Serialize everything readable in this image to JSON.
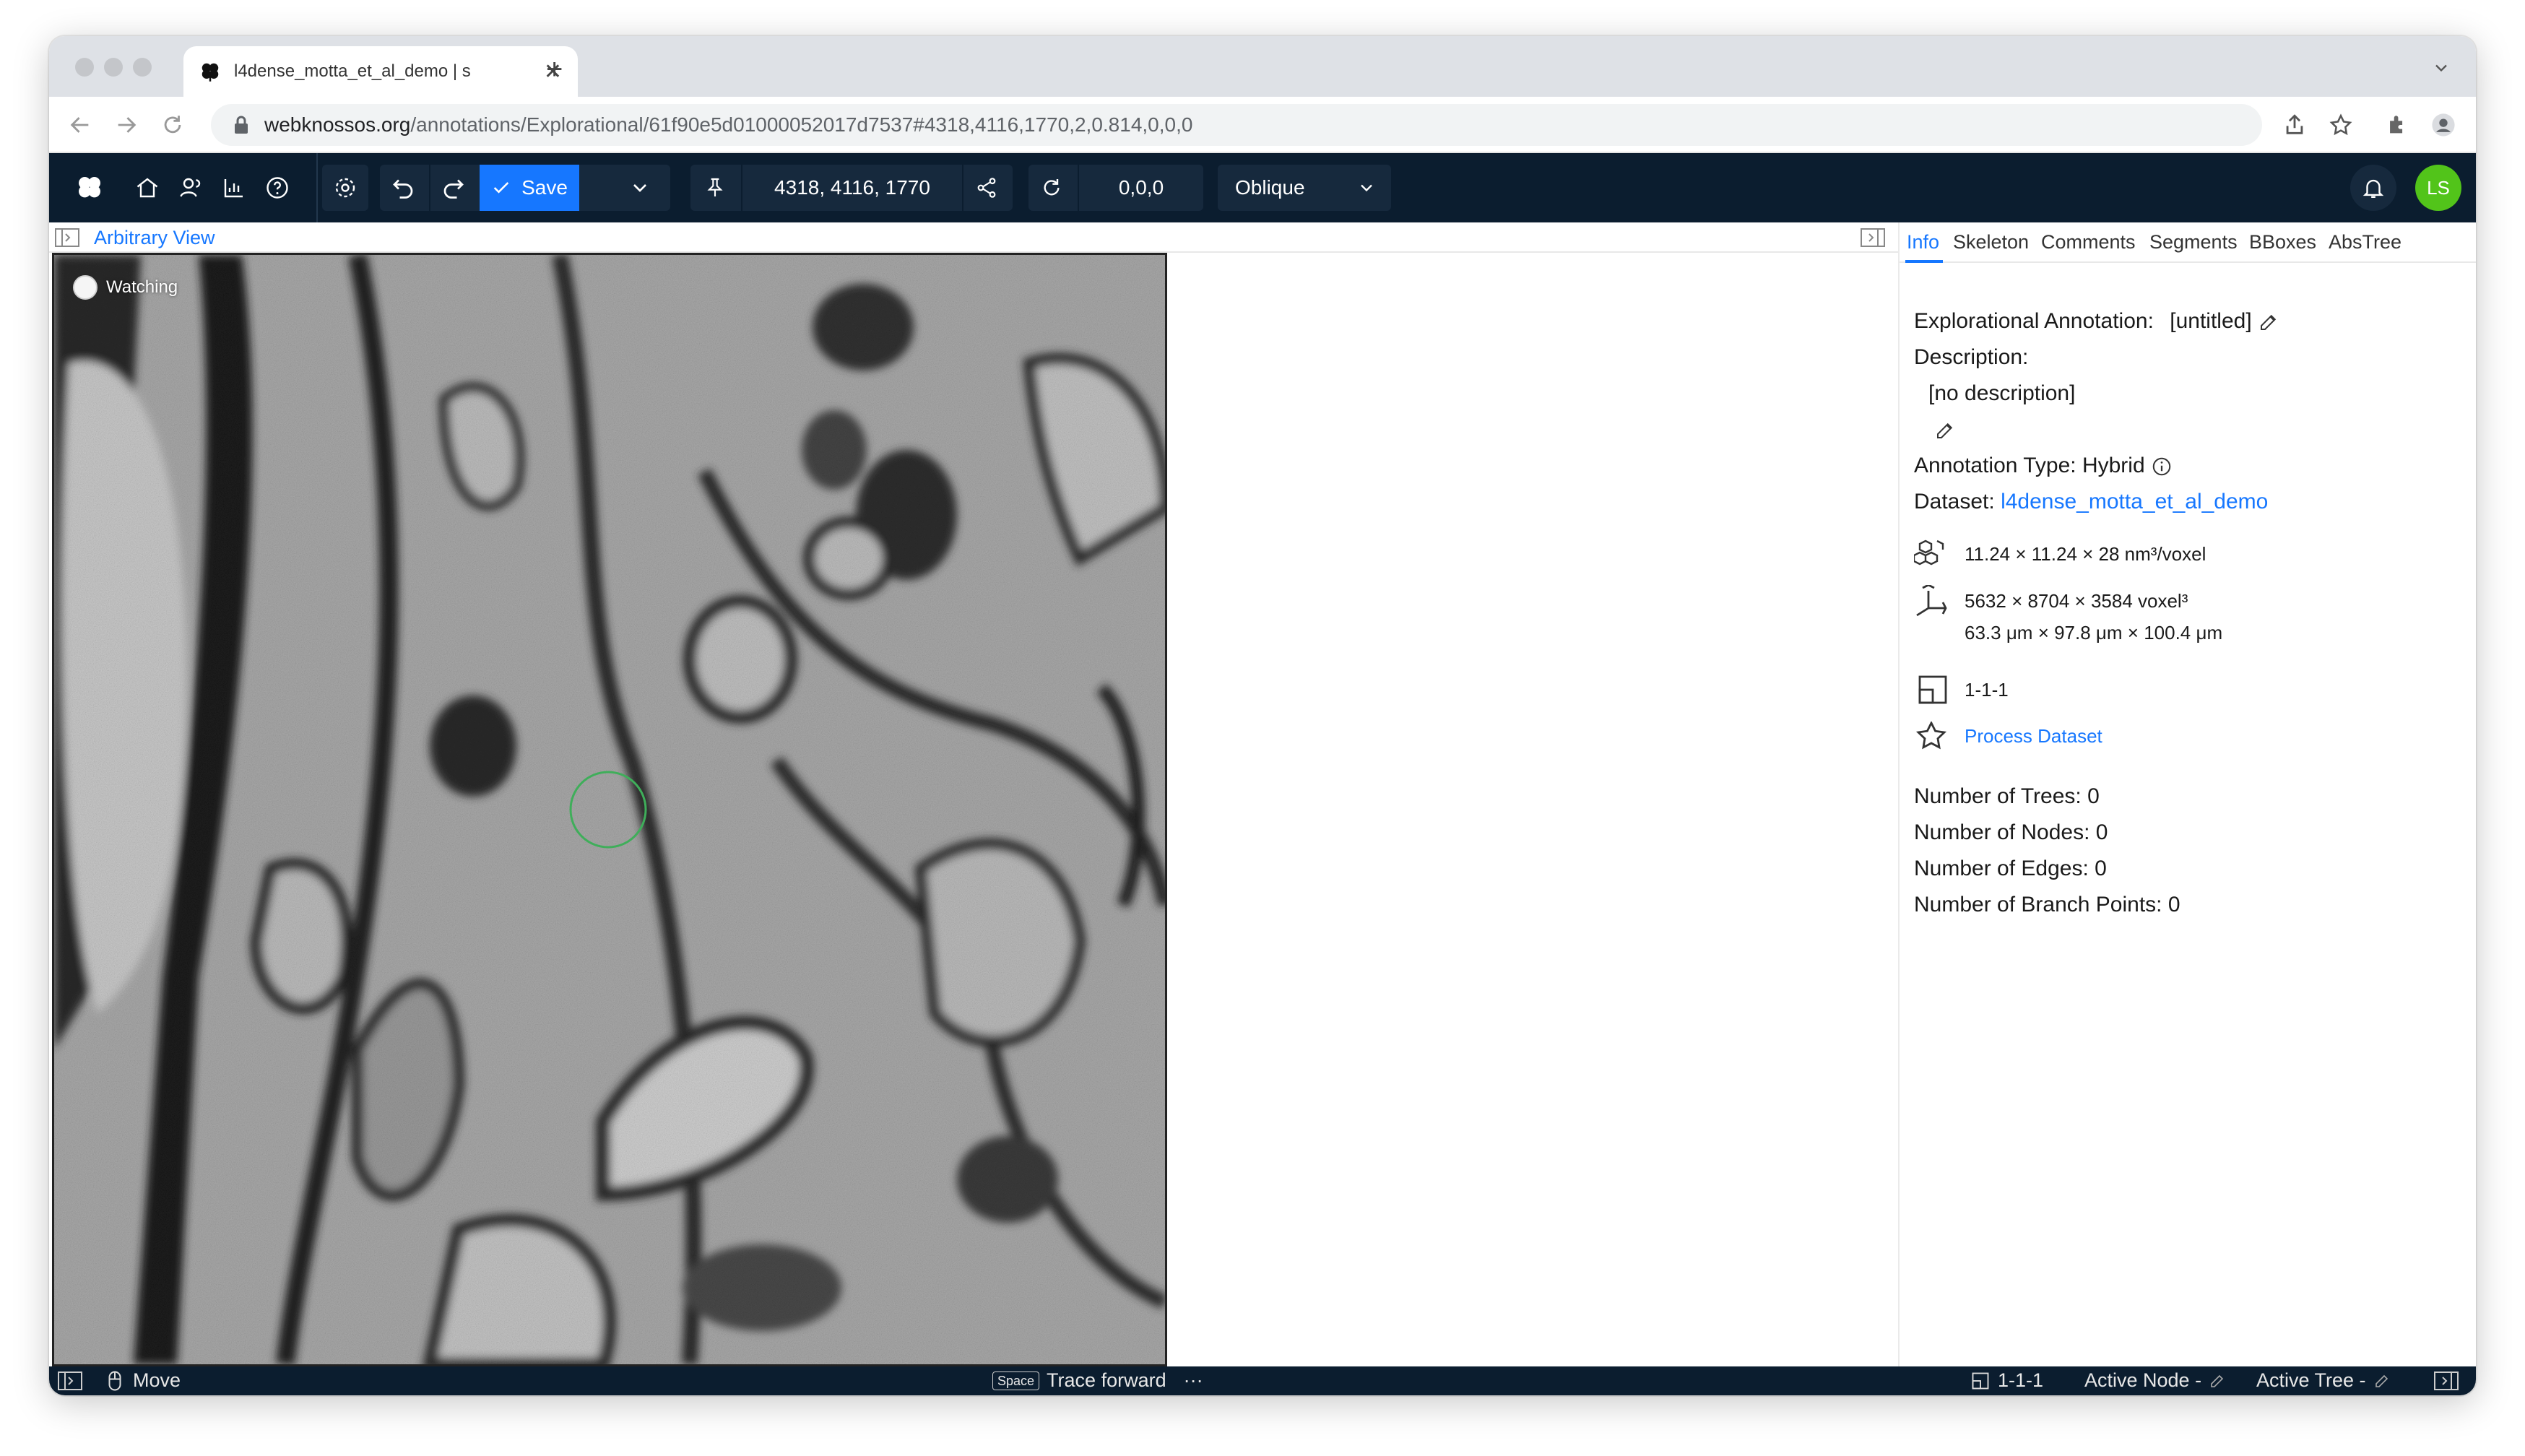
{
  "browser": {
    "tab_title": "l4dense_motta_et_al_demo | s",
    "url_host": "webknossos.org",
    "url_path": "/annotations/Explorational/61f90e5d01000052017d7537#4318,4116,1770,2,0.814,0,0,0"
  },
  "toolbar": {
    "save_label": "Save",
    "position": "4318, 4116, 1770",
    "rotation": "0,0,0",
    "view_mode": "Oblique",
    "user_initials": "LS"
  },
  "viewport": {
    "view_title": "Arbitrary View",
    "watching_label": "Watching",
    "crosshair_color": "#3fae5a"
  },
  "panel": {
    "tabs": [
      "Info",
      "Skeleton",
      "Comments",
      "Segments",
      "BBoxes",
      "AbsTree"
    ],
    "active_tab": "Info",
    "annotation_label": "Explorational Annotation:",
    "annotation_name": "[untitled]",
    "description_label": "Description:",
    "description_value": "[no description]",
    "annotation_type": "Annotation Type: Hybrid",
    "dataset_label": "Dataset:",
    "dataset_name": "l4dense_motta_et_al_demo",
    "voxel_size": "11.24 × 11.24 × 28 nm³/voxel",
    "extent_voxels": "5632 × 8704 × 3584 voxel³",
    "extent_um": "63.3 μm × 97.8 μm × 100.4 μm",
    "resolution": "1-1-1",
    "process_dataset": "Process Dataset",
    "num_trees": "Number of Trees: 0",
    "num_nodes": "Number of Nodes: 0",
    "num_edges": "Number of Edges: 0",
    "num_branch_points": "Number of Branch Points: 0"
  },
  "statusbar": {
    "move": "Move",
    "space_key": "Space",
    "trace_forward": "Trace forward",
    "more": "···",
    "resolution": "1-1-1",
    "active_node": "Active Node -",
    "active_tree": "Active Tree -"
  },
  "colors": {
    "accent": "#1677ff",
    "toolbar_bg": "#0b1d2f",
    "avatar_bg": "#52c41a"
  }
}
